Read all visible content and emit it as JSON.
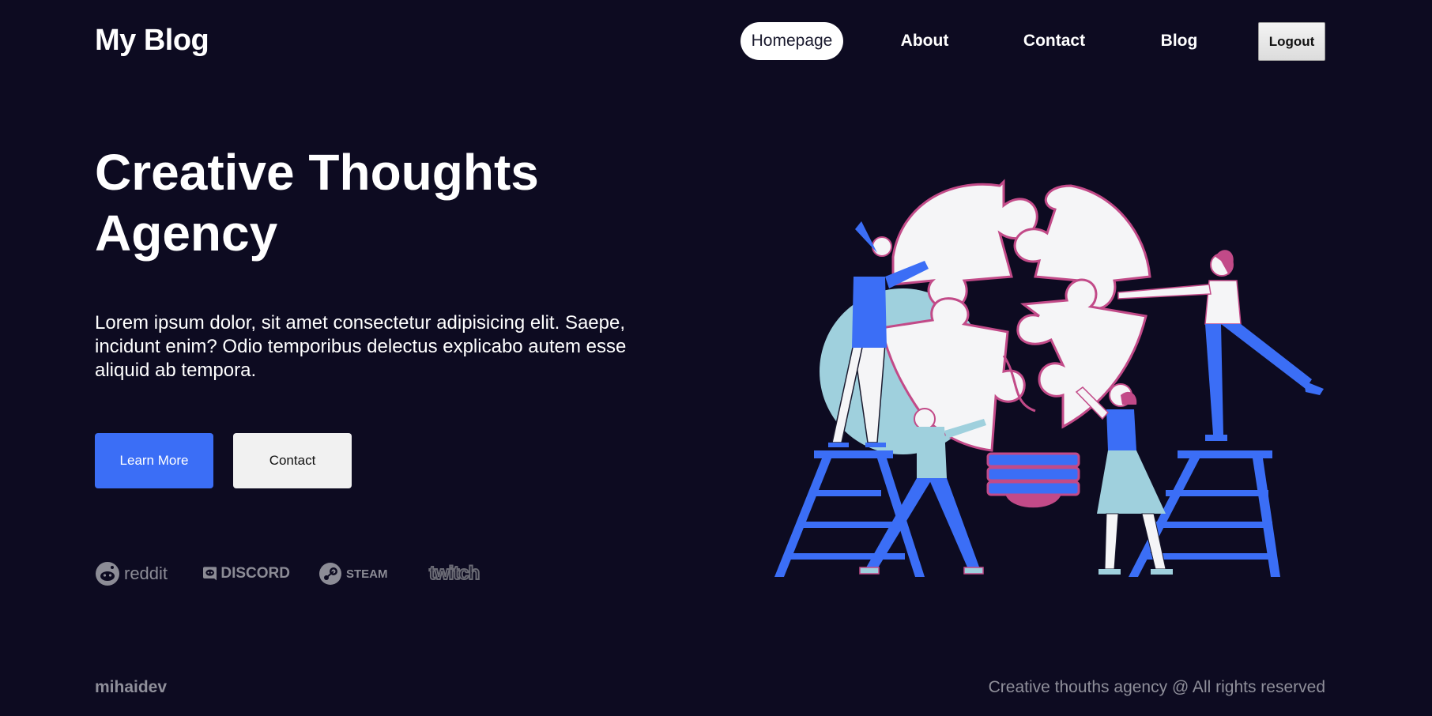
{
  "header": {
    "logo": "My Blog",
    "nav": [
      {
        "label": "Homepage",
        "active": true
      },
      {
        "label": "About",
        "active": false
      },
      {
        "label": "Contact",
        "active": false
      },
      {
        "label": "Blog",
        "active": false
      }
    ],
    "logout_label": "Logout"
  },
  "hero": {
    "title": "Creative Thoughts Agency",
    "text": "Lorem ipsum dolor, sit amet consectetur adipisicing elit. Saepe, incidunt enim? Odio temporibus delectus explicabo autem esse aliquid ab tempora.",
    "primary_button": "Learn More",
    "secondary_button": "Contact",
    "illustration_icon": "team-puzzle-illustration"
  },
  "partners": [
    {
      "name": "reddit",
      "icon": "reddit-icon"
    },
    {
      "name": "DISCORD",
      "icon": "discord-icon"
    },
    {
      "name": "STEAM",
      "icon": "steam-icon"
    },
    {
      "name": "twitch",
      "icon": "twitch-icon"
    }
  ],
  "footer": {
    "author": "mihaidev",
    "rights": "Creative thouths agency @ All rights reserved"
  },
  "colors": {
    "background": "#0d0b21",
    "accent_blue": "#3b6ef6",
    "puzzle_pink": "#c24a88",
    "light_teal": "#9fd0dd",
    "muted_text": "#8f8f9a"
  }
}
